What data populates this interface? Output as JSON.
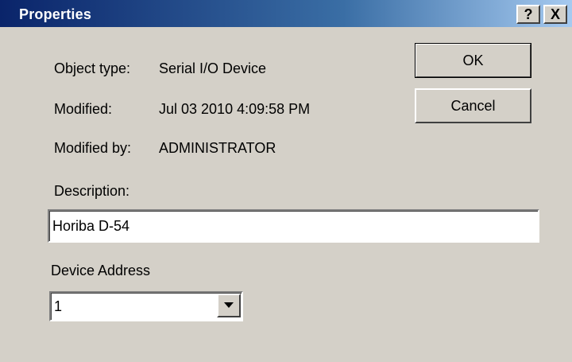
{
  "window": {
    "title": "Properties",
    "help_label": "?",
    "close_label": "X"
  },
  "info": {
    "object_type_label": "Object type:",
    "object_type_value": "Serial I/O Device",
    "modified_label": "Modified:",
    "modified_value": "Jul 03 2010 4:09:58 PM",
    "modified_by_label": "Modified by:",
    "modified_by_value": "ADMINISTRATOR"
  },
  "buttons": {
    "ok_label": "OK",
    "cancel_label": "Cancel"
  },
  "description": {
    "label": "Description:",
    "value": "Horiba D-54"
  },
  "device_address": {
    "label": "Device Address",
    "selected": "1"
  },
  "colors": {
    "dialog_face": "#d4d0c8",
    "titlebar_start": "#0a246a",
    "titlebar_end": "#a6caf0"
  },
  "icons": {
    "dropdown": "chevron-down-icon"
  }
}
